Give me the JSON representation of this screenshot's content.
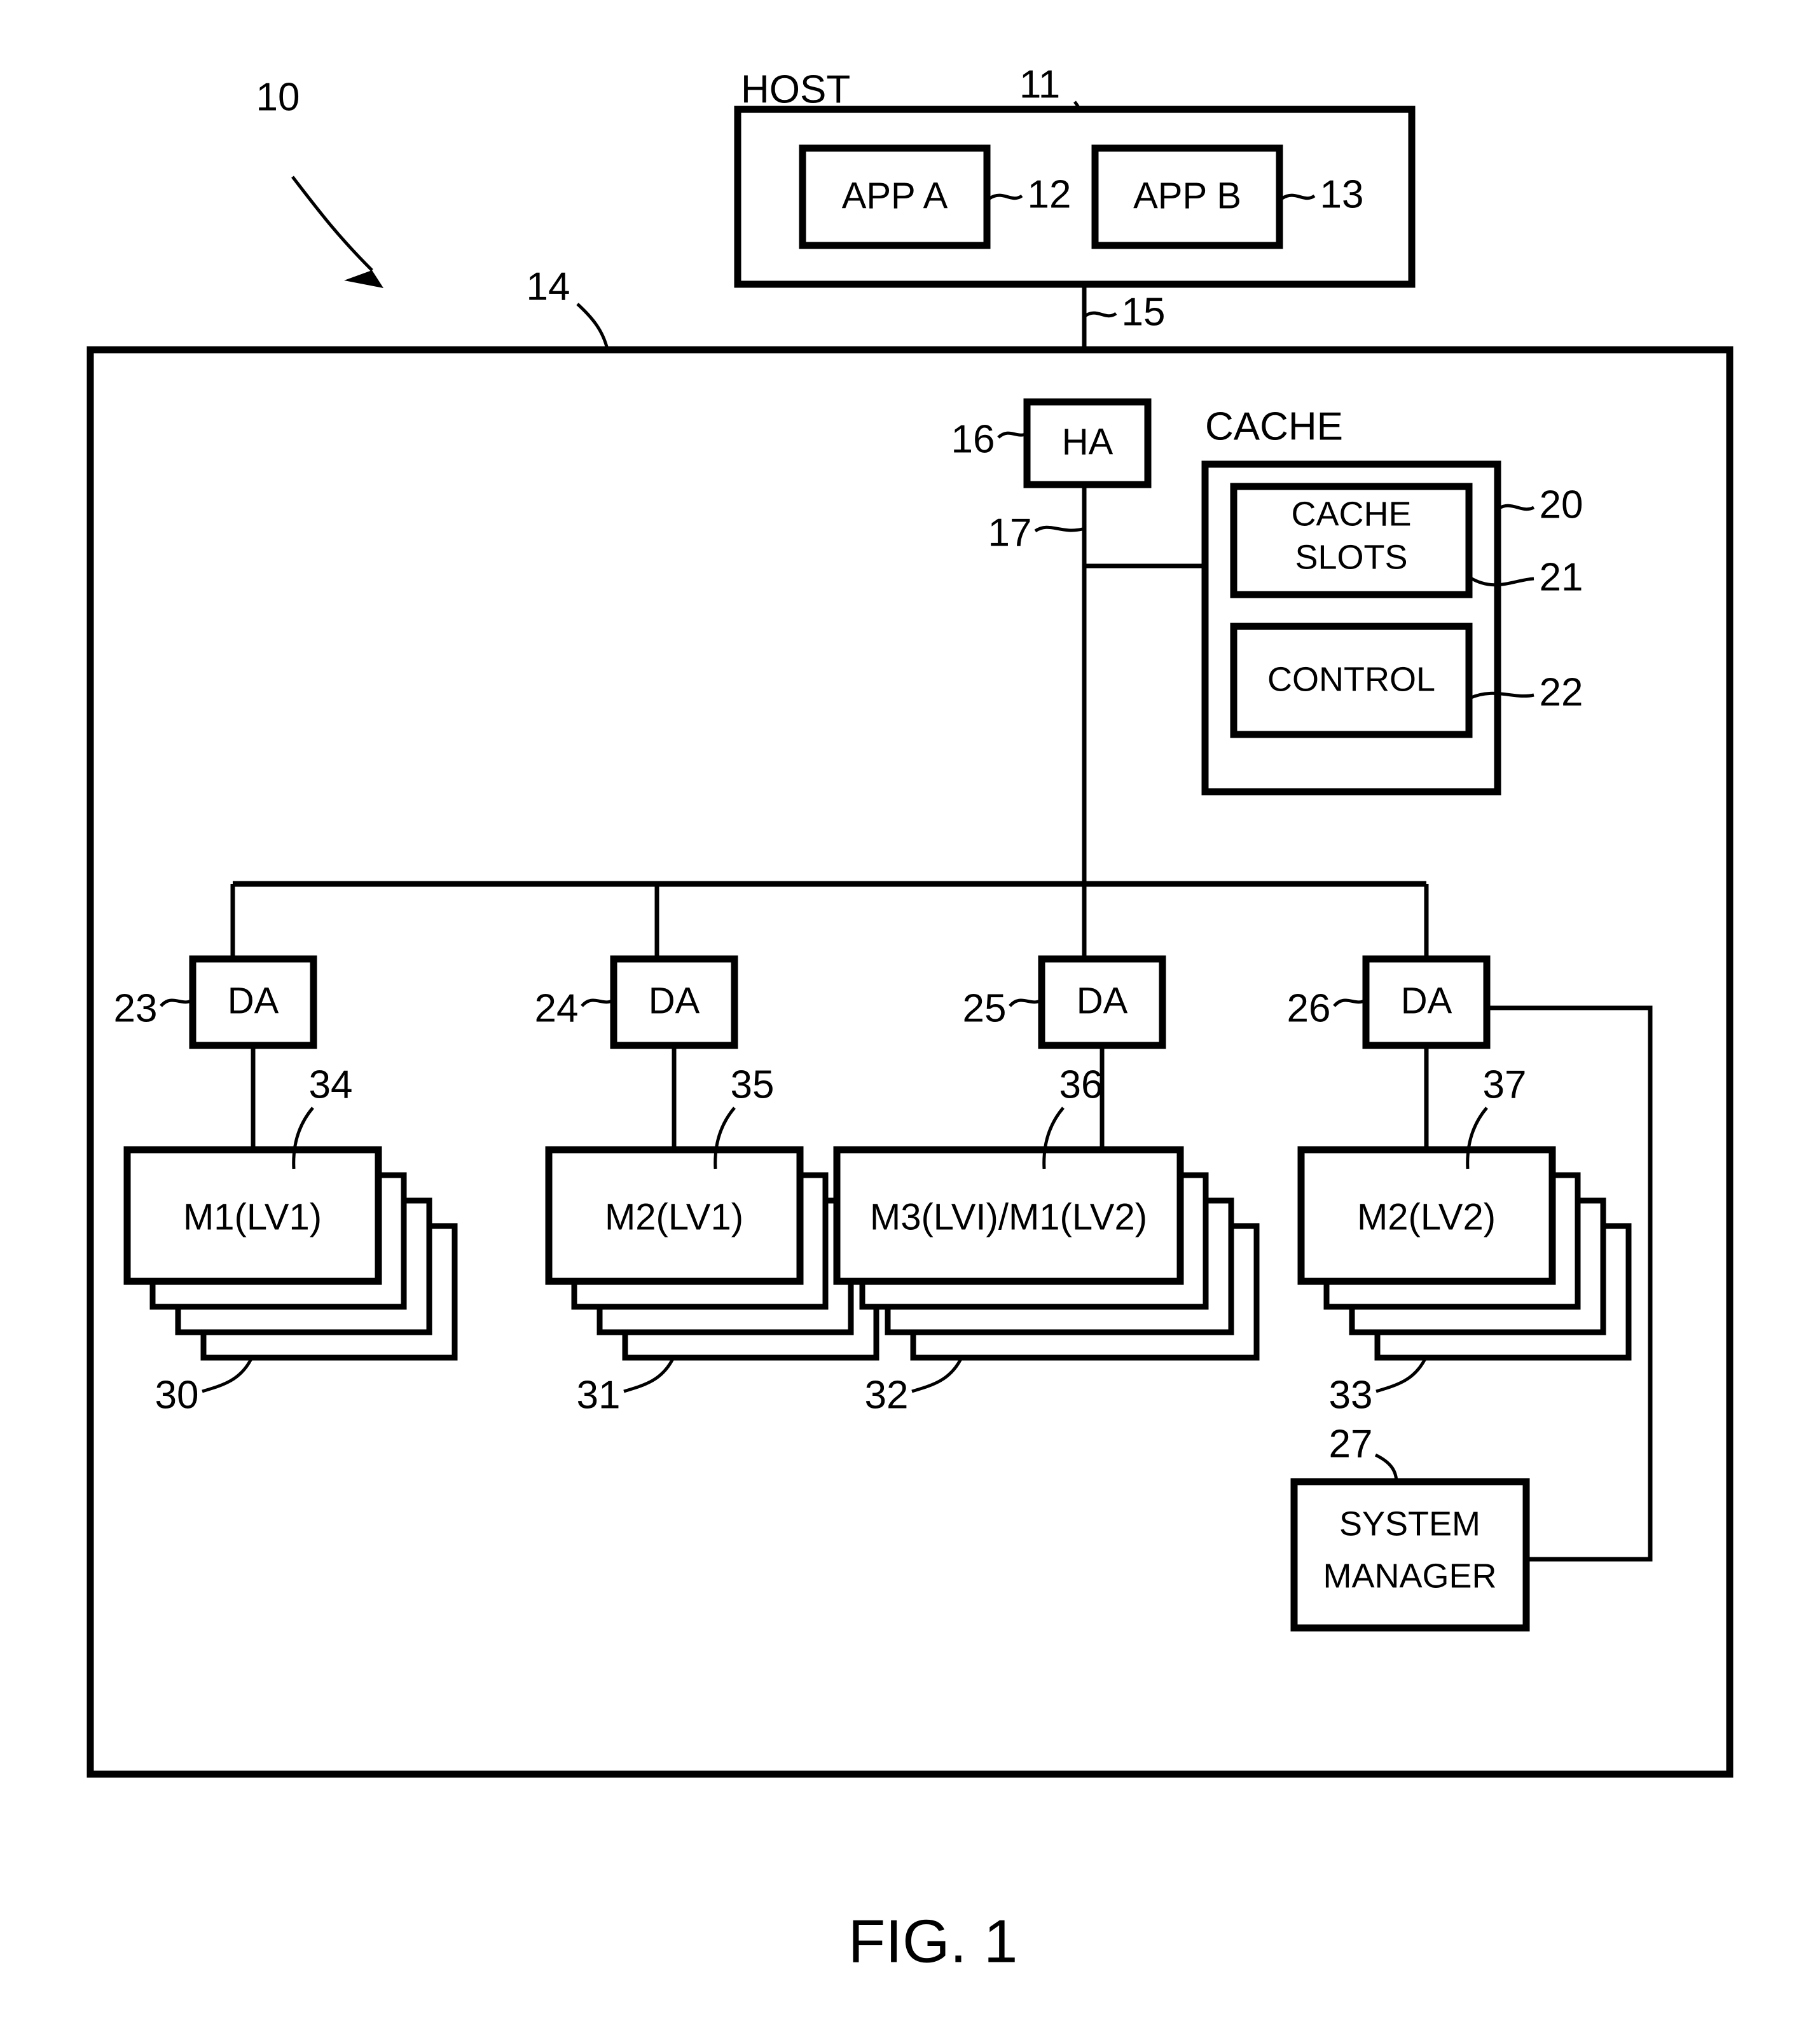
{
  "figure": {
    "caption": "FIG. 1",
    "system_ref": "10"
  },
  "host": {
    "label": "HOST",
    "ref": "11",
    "apps": [
      {
        "label": "APP A",
        "ref": "12"
      },
      {
        "label": "APP B",
        "ref": "13"
      }
    ],
    "link_ref": "15"
  },
  "storage_system": {
    "ref": "14"
  },
  "host_adapter": {
    "label": "HA",
    "ref": "16",
    "bus_ref": "17"
  },
  "cache": {
    "label": "CACHE",
    "ref": "20",
    "slots": {
      "label": "CACHE\nSLOTS",
      "line1": "CACHE",
      "line2": "SLOTS",
      "ref": "21"
    },
    "control": {
      "label": "CONTROL",
      "ref": "22"
    }
  },
  "disk_adapters": [
    {
      "label": "DA",
      "ref": "23"
    },
    {
      "label": "DA",
      "ref": "24"
    },
    {
      "label": "DA",
      "ref": "25"
    },
    {
      "label": "DA",
      "ref": "26"
    }
  ],
  "device_stacks": [
    {
      "front_label": "M1(LV1)",
      "front_ref": "34",
      "stack_ref": "30",
      "count": 4
    },
    {
      "front_label": "M2(LV1)",
      "front_ref": "35",
      "stack_ref": "31",
      "count": 4
    },
    {
      "front_label": "M3(LVI)/M1(LV2)",
      "front_ref": "36",
      "stack_ref": "32",
      "count": 4
    },
    {
      "front_label": "M2(LV2)",
      "front_ref": "37",
      "stack_ref": "33",
      "count": 4
    }
  ],
  "system_manager": {
    "line1": "SYSTEM",
    "line2": "MANAGER",
    "ref": "27"
  },
  "colors": {
    "ink": "#000000",
    "paper": "#ffffff"
  }
}
